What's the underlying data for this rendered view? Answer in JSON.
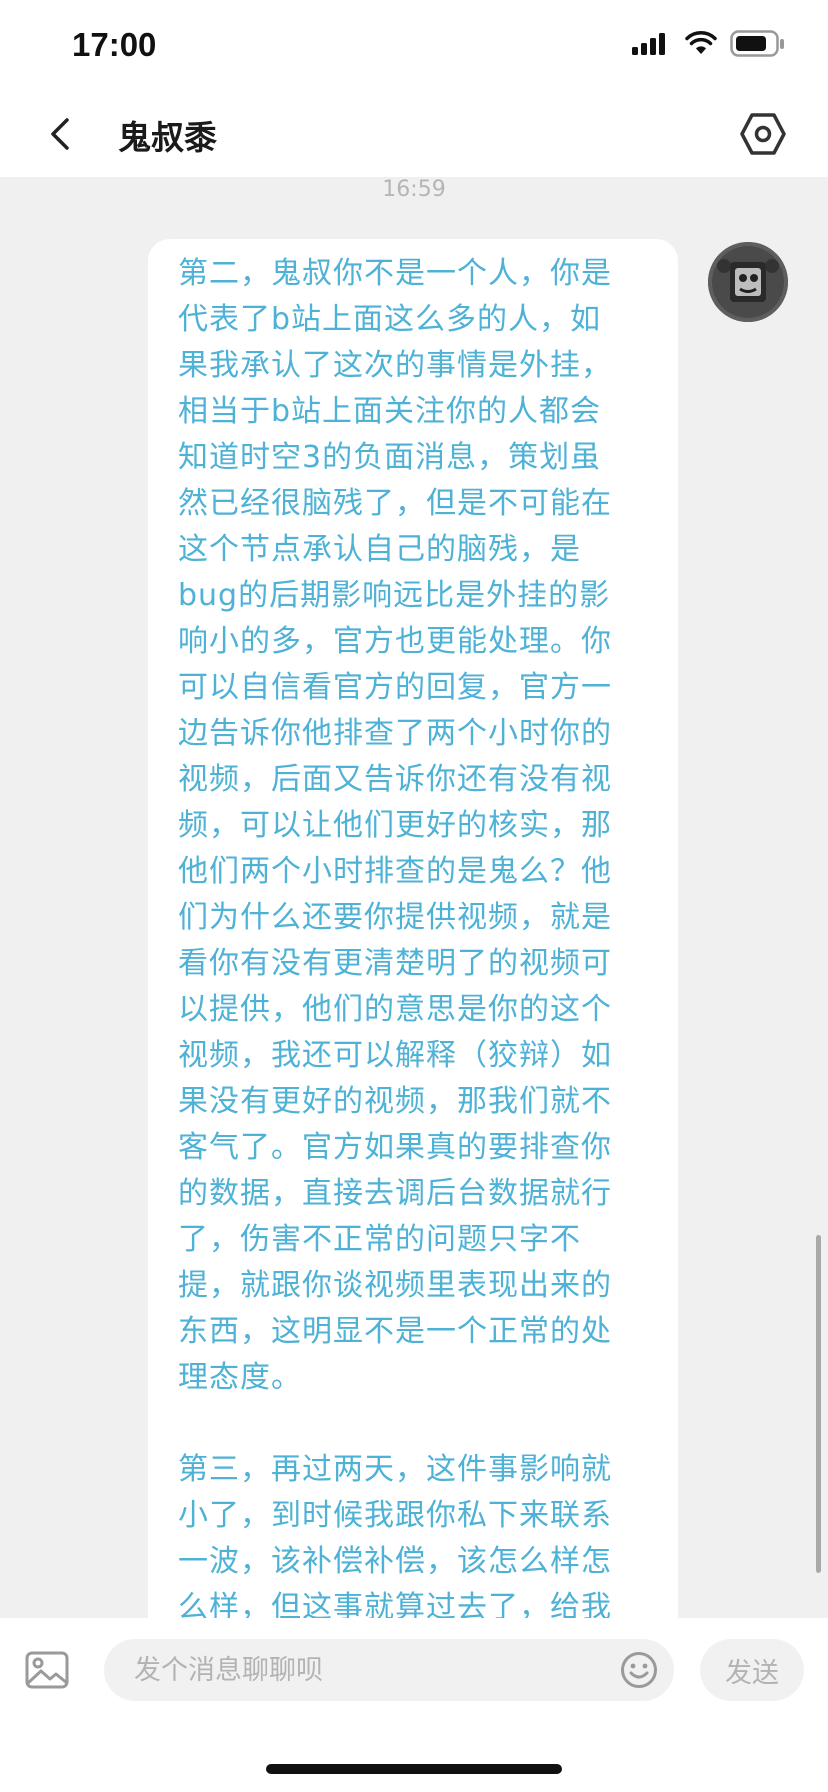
{
  "status_bar": {
    "time": "17:00"
  },
  "nav": {
    "title": "鬼叔黍"
  },
  "chat": {
    "timestamp": "16:59",
    "message_paragraphs": [
      "第二，鬼叔你不是一个人，你是\n代表了b站上面这么多的人，如\n果我承认了这次的事情是外挂，\n相当于b站上面关注你的人都会\n知道时空3的负面消息，策划虽\n然已经很脑残了，但是不可能在\n这个节点承认自己的脑残，是\nbug的后期影响远比是外挂的影\n响小的多，官方也更能处理。你\n可以自信看官方的回复，官方一\n边告诉你他排查了两个小时你的\n视频，后面又告诉你还有没有视\n频，可以让他们更好的核实，那\n他们两个小时排查的是鬼么？他\n们为什么还要你提供视频，就是\n看你有没有更清楚明了的视频可\n以提供，他们的意思是你的这个\n视频，我还可以解释（狡辩）如\n果没有更好的视频，那我们就不\n客气了。官方如果真的要排查你\n的数据，直接去调后台数据就行\n了，伤害不正常的问题只字不\n提，就跟你谈视频里表现出来的\n东西，这明显不是一个正常的处\n理态度。",
      "第三，再过两天，这件事影响就\n小了，到时候我跟你私下来联系\n一波，该补偿补偿，该怎么样怎\n么样，但这事就算过去了，给我"
    ]
  },
  "input_bar": {
    "placeholder": "发个消息聊聊呗",
    "send_label": "发送"
  }
}
